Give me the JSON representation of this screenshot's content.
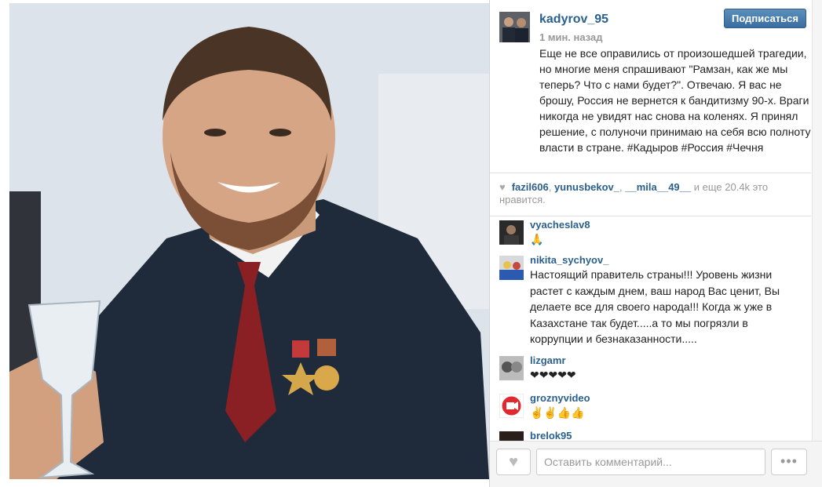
{
  "post": {
    "username": "kadyrov_95",
    "time": "1 мин. назад",
    "follow_label": "Подписаться",
    "caption": "Еще не все оправились от произошедшей трагедии, но многие меня спрашивают \"Рамзан, как же мы теперь? Что с нами будет?\". Отвечаю. Я вас не брошу, Россия не вернется к бандитизму 90-х. Враги никогда не увидят нас снова на коленях. Я принял решение, с полуночи принимаю на себя всю полноту власти в стране. #Кадыров #Россия #Чечня"
  },
  "likes": {
    "users": [
      "fazil606",
      "yunusbekov_",
      "__mila__49__"
    ],
    "rest": "и еще 20.4k это нравится."
  },
  "comments": [
    {
      "user": "vyacheslav8",
      "text": "🙏",
      "avatar": "dark"
    },
    {
      "user": "nikita_sychyov_",
      "text": "Настоящий правитель страны!!! Уровень жизни растет с каждым днем, ваш народ Вас ценит, Вы делаете все для своего народа!!! Когда ж уже в Казахстане так будет.....а то мы погрязли в коррупции и безнаказанности.....",
      "avatar": "hockey"
    },
    {
      "user": "lizgamr",
      "text": "❤❤❤❤❤",
      "avatar": "bw"
    },
    {
      "user": "groznyvideo",
      "text": "✌️✌️👍👍",
      "avatar": "video"
    },
    {
      "user": "brelok95",
      "text": "",
      "avatar": "dark"
    }
  ],
  "footer": {
    "comment_placeholder": "Оставить комментарий...",
    "more_label": "•••"
  },
  "colors": {
    "username": "#2b5f8c",
    "follow_button": "#3a6e9e",
    "muted": "#999999"
  },
  "icons": {
    "like_heart": "heart-icon",
    "more": "ellipsis-icon"
  }
}
